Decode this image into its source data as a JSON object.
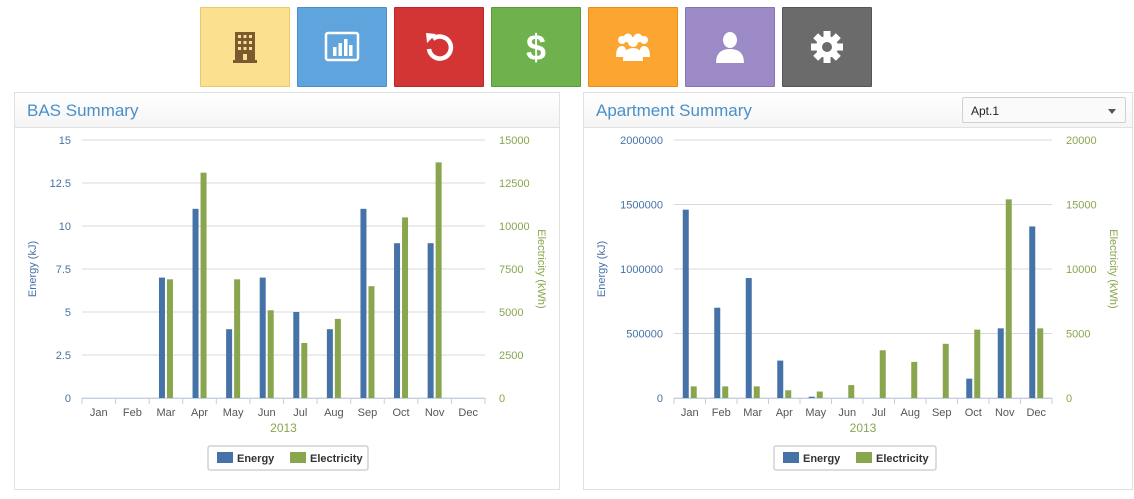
{
  "toolbar": {
    "tiles": [
      {
        "icon": "building-icon",
        "color": "#fbe08f",
        "border": "#e8c869"
      },
      {
        "icon": "bar-chart-icon",
        "color": "#5fa4dc",
        "border": "#4a8fc7"
      },
      {
        "icon": "refresh-icon",
        "color": "#d23534",
        "border": "#b82726"
      },
      {
        "icon": "dollar-icon",
        "color": "#6fb14c",
        "border": "#5a9a3b"
      },
      {
        "icon": "group-icon",
        "color": "#fca530",
        "border": "#e58e1d"
      },
      {
        "icon": "user-icon",
        "color": "#9b8ac6",
        "border": "#8675b3"
      },
      {
        "icon": "gear-icon",
        "color": "#6b6b6b",
        "border": "#555555"
      }
    ]
  },
  "bas_panel": {
    "title": "BAS Summary"
  },
  "apt_panel": {
    "title": "Apartment Summary",
    "selector_value": "Apt.1"
  },
  "chart_data": [
    {
      "type": "bar",
      "categories": [
        "Jan",
        "Feb",
        "Mar",
        "Apr",
        "May",
        "Jun",
        "Jul",
        "Aug",
        "Sep",
        "Oct",
        "Nov",
        "Dec"
      ],
      "xlabel": "2013",
      "ylabel_left": "Energy (kJ)",
      "ylabel_right": "Electricity (kWh)",
      "ylim_left": [
        0,
        15
      ],
      "ylim_right": [
        0,
        15000
      ],
      "yticks_left": [
        "0",
        "2.5",
        "5",
        "7.5",
        "10",
        "12.5",
        "15"
      ],
      "yticks_right": [
        "0",
        "2500",
        "5000",
        "7500",
        "10000",
        "12500",
        "15000"
      ],
      "grid": true,
      "legend": "bottom-center",
      "series": [
        {
          "name": "Energy",
          "axis": "left",
          "color": "#4572a7",
          "values": [
            0,
            0,
            7,
            11,
            4,
            7,
            5,
            4,
            11,
            9,
            9,
            0
          ]
        },
        {
          "name": "Electricity",
          "axis": "right",
          "color": "#89a54e",
          "values": [
            0,
            0,
            6900,
            13100,
            6900,
            5100,
            3200,
            4600,
            6500,
            10500,
            13700,
            0
          ]
        }
      ]
    },
    {
      "type": "bar",
      "categories": [
        "Jan",
        "Feb",
        "Mar",
        "Apr",
        "May",
        "Jun",
        "Jul",
        "Aug",
        "Sep",
        "Oct",
        "Nov",
        "Dec"
      ],
      "xlabel": "2013",
      "ylabel_left": "Energy (kJ)",
      "ylabel_right": "Electricity (kWh)",
      "ylim_left": [
        0,
        2000000
      ],
      "ylim_right": [
        0,
        20000
      ],
      "yticks_left": [
        "0",
        "500000",
        "1000000",
        "1500000",
        "2000000"
      ],
      "yticks_right": [
        "0",
        "5000",
        "10000",
        "15000",
        "20000"
      ],
      "grid": true,
      "legend": "bottom-center",
      "series": [
        {
          "name": "Energy",
          "axis": "left",
          "color": "#4572a7",
          "values": [
            1460000,
            700000,
            930000,
            290000,
            10000,
            0,
            0,
            0,
            0,
            150000,
            540000,
            1330000
          ]
        },
        {
          "name": "Electricity",
          "axis": "right",
          "color": "#89a54e",
          "values": [
            900,
            900,
            900,
            600,
            500,
            1000,
            3700,
            2800,
            4200,
            5300,
            15400,
            5400
          ]
        }
      ]
    }
  ]
}
